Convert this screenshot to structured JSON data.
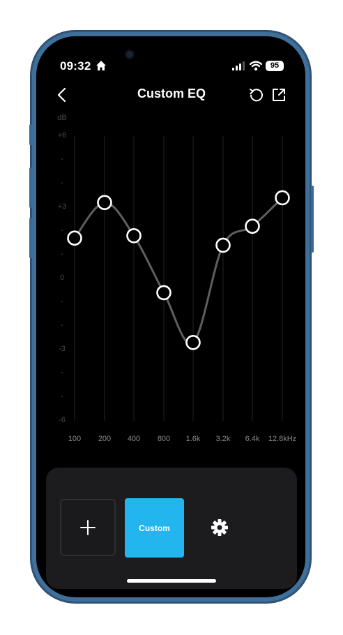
{
  "status_bar": {
    "time": "09:32",
    "battery": "95"
  },
  "header": {
    "title": "Custom EQ"
  },
  "db_axis": {
    "unit": "dB",
    "labels": [
      "+6",
      "-",
      "-",
      "+3",
      "-",
      "-",
      "0",
      "-",
      "-",
      "-3",
      "-",
      "-",
      "-6"
    ]
  },
  "frequency_axis": {
    "labels": [
      "100",
      "200",
      "400",
      "800",
      "1.6k",
      "3.2k",
      "6.4k",
      "12.8kHz"
    ]
  },
  "chart_data": {
    "type": "line",
    "x": [
      "100",
      "200",
      "400",
      "800",
      "1.6k",
      "3.2k",
      "6.4k",
      "12.8kHz"
    ],
    "series": [
      {
        "values": [
          1.7,
          3.2,
          1.8,
          -0.6,
          -2.7,
          1.4,
          2.2,
          3.4
        ]
      }
    ],
    "ylabel": "dB",
    "ylim": [
      -6,
      6
    ],
    "grid": true
  },
  "panel": {
    "custom_label": "Custom"
  },
  "colors": {
    "accent": "#23b6ee",
    "background": "#000000",
    "panel": "#1c1c1e"
  }
}
